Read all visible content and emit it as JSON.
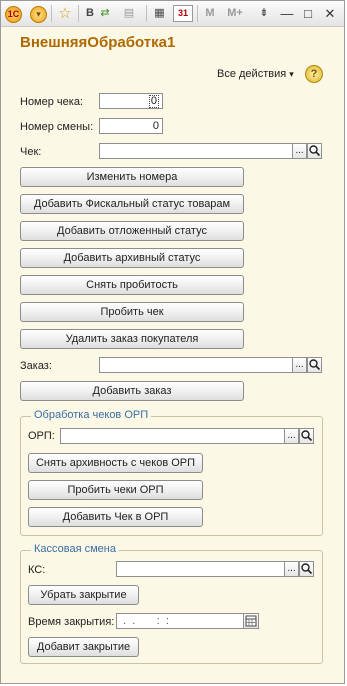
{
  "toolbar": {
    "app_icon": "1C",
    "menu_icon": "▾",
    "favorite_icon": "☆",
    "bold_label": "B",
    "go_icon": "⇄",
    "print_icon": "▤",
    "calc_icon": "▦",
    "calendar_icon": "31",
    "m_label": "M",
    "mplus_label": "M+",
    "more_icon": "⇟",
    "minimize_icon": "—",
    "maximize_icon": "□",
    "close_icon": "✕"
  },
  "form": {
    "title": "ВнешняяОбработка1",
    "all_actions_label": "Все действия",
    "all_actions_arrow": "▾",
    "help_label": "?"
  },
  "fields": {
    "check_number_label": "Номер чека:",
    "check_number_value": "0",
    "shift_number_label": "Номер смены:",
    "shift_number_value": "0",
    "check_label": "Чек:",
    "check_value": "",
    "order_label": "Заказ:",
    "order_value": ""
  },
  "buttons": {
    "change_numbers": "Изменить номера",
    "add_fiscal_status": "Добавить Фискальный статус товарам",
    "add_deferred_status": "Добавить отложенный статус",
    "add_archive_status": "Добавить архивный статус",
    "remove_punch": "Снять пробитость",
    "punch_check": "Пробить чек",
    "delete_customer_order": "Удалить заказ покупателя",
    "add_order": "Добавить заказ"
  },
  "orp_group": {
    "title": "Обработка чеков ОРП",
    "orp_label": "ОРП:",
    "orp_value": "",
    "remove_archive_button": "Снять архивность с чеков ОРП",
    "punch_orp_button": "Пробить чеки ОРП",
    "add_check_orp_button": "Добавить Чек в ОРП"
  },
  "cash_shift_group": {
    "title": "Кассовая смена",
    "ks_label": "КС:",
    "ks_value": "",
    "remove_closing_button": "Убрать закрытие",
    "closing_time_label": "Время закрытия:",
    "closing_time_value": " .  .       :  :",
    "add_closing_button": "Добавит закрытие"
  },
  "common": {
    "ellipsis": "...",
    "search_icon": "search-icon",
    "calendar_field_icon": "calendar-icon"
  }
}
